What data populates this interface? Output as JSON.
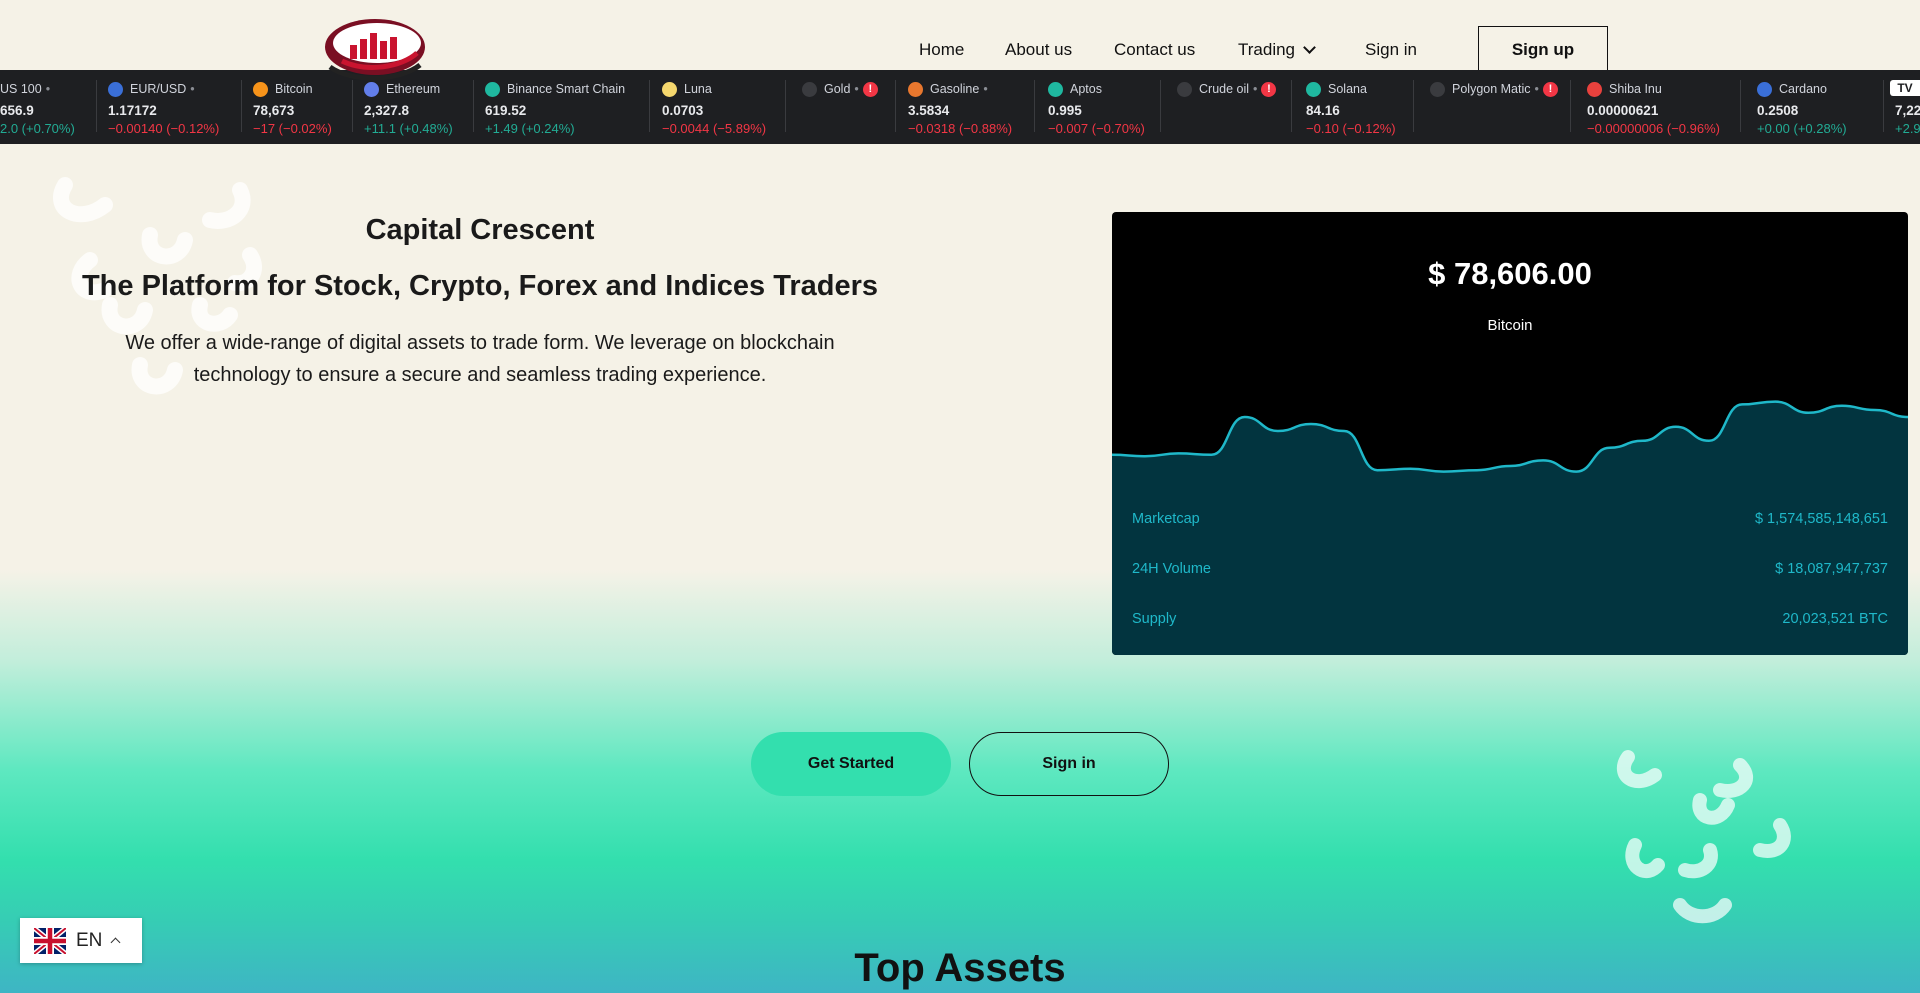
{
  "nav": {
    "logo_text": "Capital Crescent",
    "home": "Home",
    "about": "About us",
    "contact": "Contact us",
    "trading": "Trading",
    "signin": "Sign in",
    "signup": "Sign up"
  },
  "ticker": [
    {
      "name": "US 100",
      "price": "656.9",
      "change": "2.0 (+0.70%)",
      "dir": "up",
      "dot": "none",
      "bullet": true,
      "warn": false
    },
    {
      "name": "EUR/USD",
      "price": "1.17172",
      "change": "−0.00140 (−0.12%)",
      "dir": "down",
      "dot": "#3a6fd8",
      "bullet": true,
      "warn": false
    },
    {
      "name": "Bitcoin",
      "price": "78,673",
      "change": "−17 (−0.02%)",
      "dir": "down",
      "dot": "#f7931a",
      "bullet": false,
      "warn": false
    },
    {
      "name": "Ethereum",
      "price": "2,327.8",
      "change": "+11.1 (+0.48%)",
      "dir": "up",
      "dot": "#627eea",
      "bullet": false,
      "warn": false
    },
    {
      "name": "Binance Smart Chain",
      "price": "619.52",
      "change": "+1.49 (+0.24%)",
      "dir": "up",
      "dot": "#1fb8a0",
      "bullet": false,
      "warn": false
    },
    {
      "name": "Luna",
      "price": "0.0703",
      "change": "−0.0044 (−5.89%)",
      "dir": "down",
      "dot": "#f5d76e",
      "bullet": false,
      "warn": false
    },
    {
      "name": "Gold",
      "price": "",
      "change": "",
      "dir": "up",
      "dot": "#3a3b3f",
      "bullet": true,
      "warn": true
    },
    {
      "name": "Gasoline",
      "price": "3.5834",
      "change": "−0.0318 (−0.88%)",
      "dir": "down",
      "dot": "#e8772e",
      "bullet": true,
      "warn": false
    },
    {
      "name": "Aptos",
      "price": "0.995",
      "change": "−0.007 (−0.70%)",
      "dir": "down",
      "dot": "#1fb8a0",
      "bullet": false,
      "warn": false
    },
    {
      "name": "Crude oil",
      "price": "",
      "change": "",
      "dir": "up",
      "dot": "#3a3b3f",
      "bullet": true,
      "warn": true
    },
    {
      "name": "Solana",
      "price": "84.16",
      "change": "−0.10 (−0.12%)",
      "dir": "down",
      "dot": "#1fb8a0",
      "bullet": false,
      "warn": false
    },
    {
      "name": "Polygon Matic",
      "price": "",
      "change": "",
      "dir": "up",
      "dot": "#3a3b3f",
      "bullet": true,
      "warn": true
    },
    {
      "name": "Shiba Inu",
      "price": "0.00000621",
      "change": "−0.00000006 (−0.96%)",
      "dir": "down",
      "dot": "#e8413d",
      "bullet": false,
      "warn": false
    },
    {
      "name": "Cardano",
      "price": "0.2508",
      "change": "+0.00 (+0.28%)",
      "dir": "up",
      "dot": "#3a6fd8",
      "bullet": false,
      "warn": false
    },
    {
      "name": "",
      "price": "7,22",
      "change": "+2.9",
      "dir": "up",
      "dot": "none",
      "bullet": false,
      "warn": false
    }
  ],
  "hero": {
    "title": "Capital Crescent",
    "headline": "The Platform for Stock, Crypto, Forex and Indices Traders",
    "description": "We offer a wide-range of digital assets to trade form. We leverage on blockchain technology to ensure a secure and seamless trading experience."
  },
  "card": {
    "price": "$ 78,606.00",
    "asset": "Bitcoin",
    "rows": [
      {
        "label": "Marketcap",
        "value": "$ 1,574,585,148,651"
      },
      {
        "label": "24H Volume",
        "value": "$ 18,087,947,737"
      },
      {
        "label": "Supply",
        "value": "20,023,521 BTC"
      }
    ],
    "sparkline": [
      52,
      53,
      51,
      52,
      25,
      35,
      30,
      35,
      63,
      62,
      64,
      63,
      60,
      56,
      64,
      47,
      42,
      32,
      42,
      16,
      14,
      22,
      17,
      20,
      25
    ],
    "line_color": "#1fb8c9",
    "fill_color": "#02343f"
  },
  "cta": {
    "get_started": "Get Started",
    "signin": "Sign in"
  },
  "section": {
    "top_assets": "Top Assets"
  },
  "language": {
    "code": "EN"
  }
}
